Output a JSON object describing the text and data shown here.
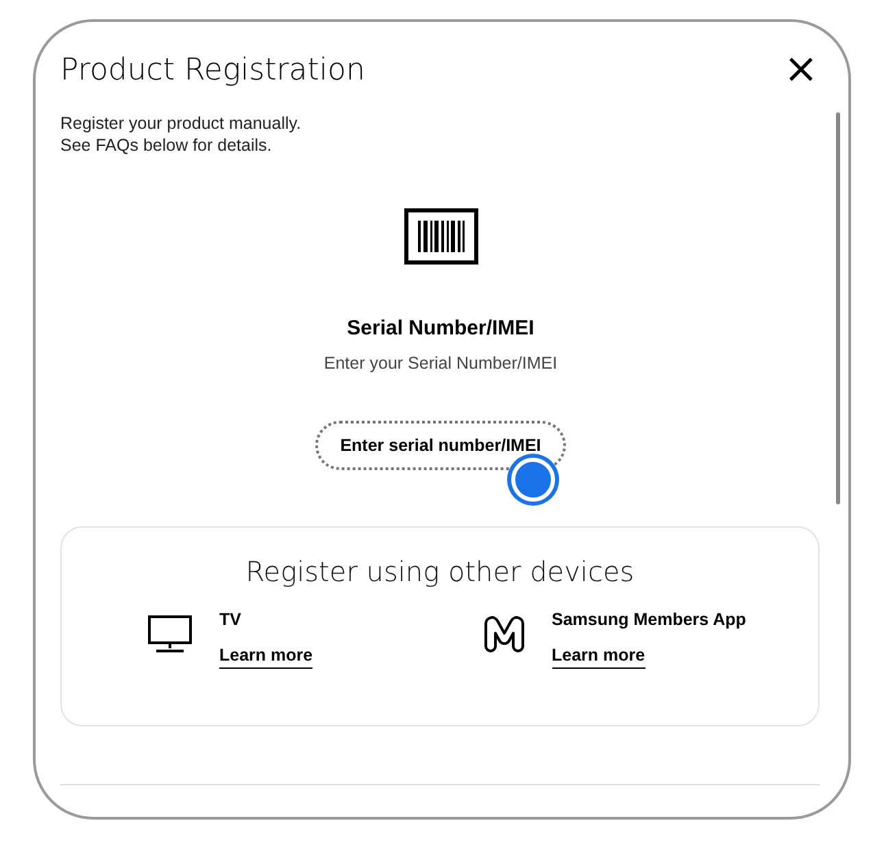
{
  "dialog": {
    "title": "Product Registration",
    "close": "×",
    "description": [
      "Register your product manually.",
      "See FAQs below for details."
    ]
  },
  "serial": {
    "heading": "Serial Number/IMEI",
    "hint": "Enter your Serial Number/IMEI",
    "button": "Enter serial number/IMEI"
  },
  "other_devices": {
    "heading": "Register using other devices",
    "items": [
      {
        "kind": "tv",
        "name": "TV",
        "link": "Learn more"
      },
      {
        "kind": "app",
        "name": "Samsung Members App",
        "link": "Learn more"
      }
    ]
  }
}
